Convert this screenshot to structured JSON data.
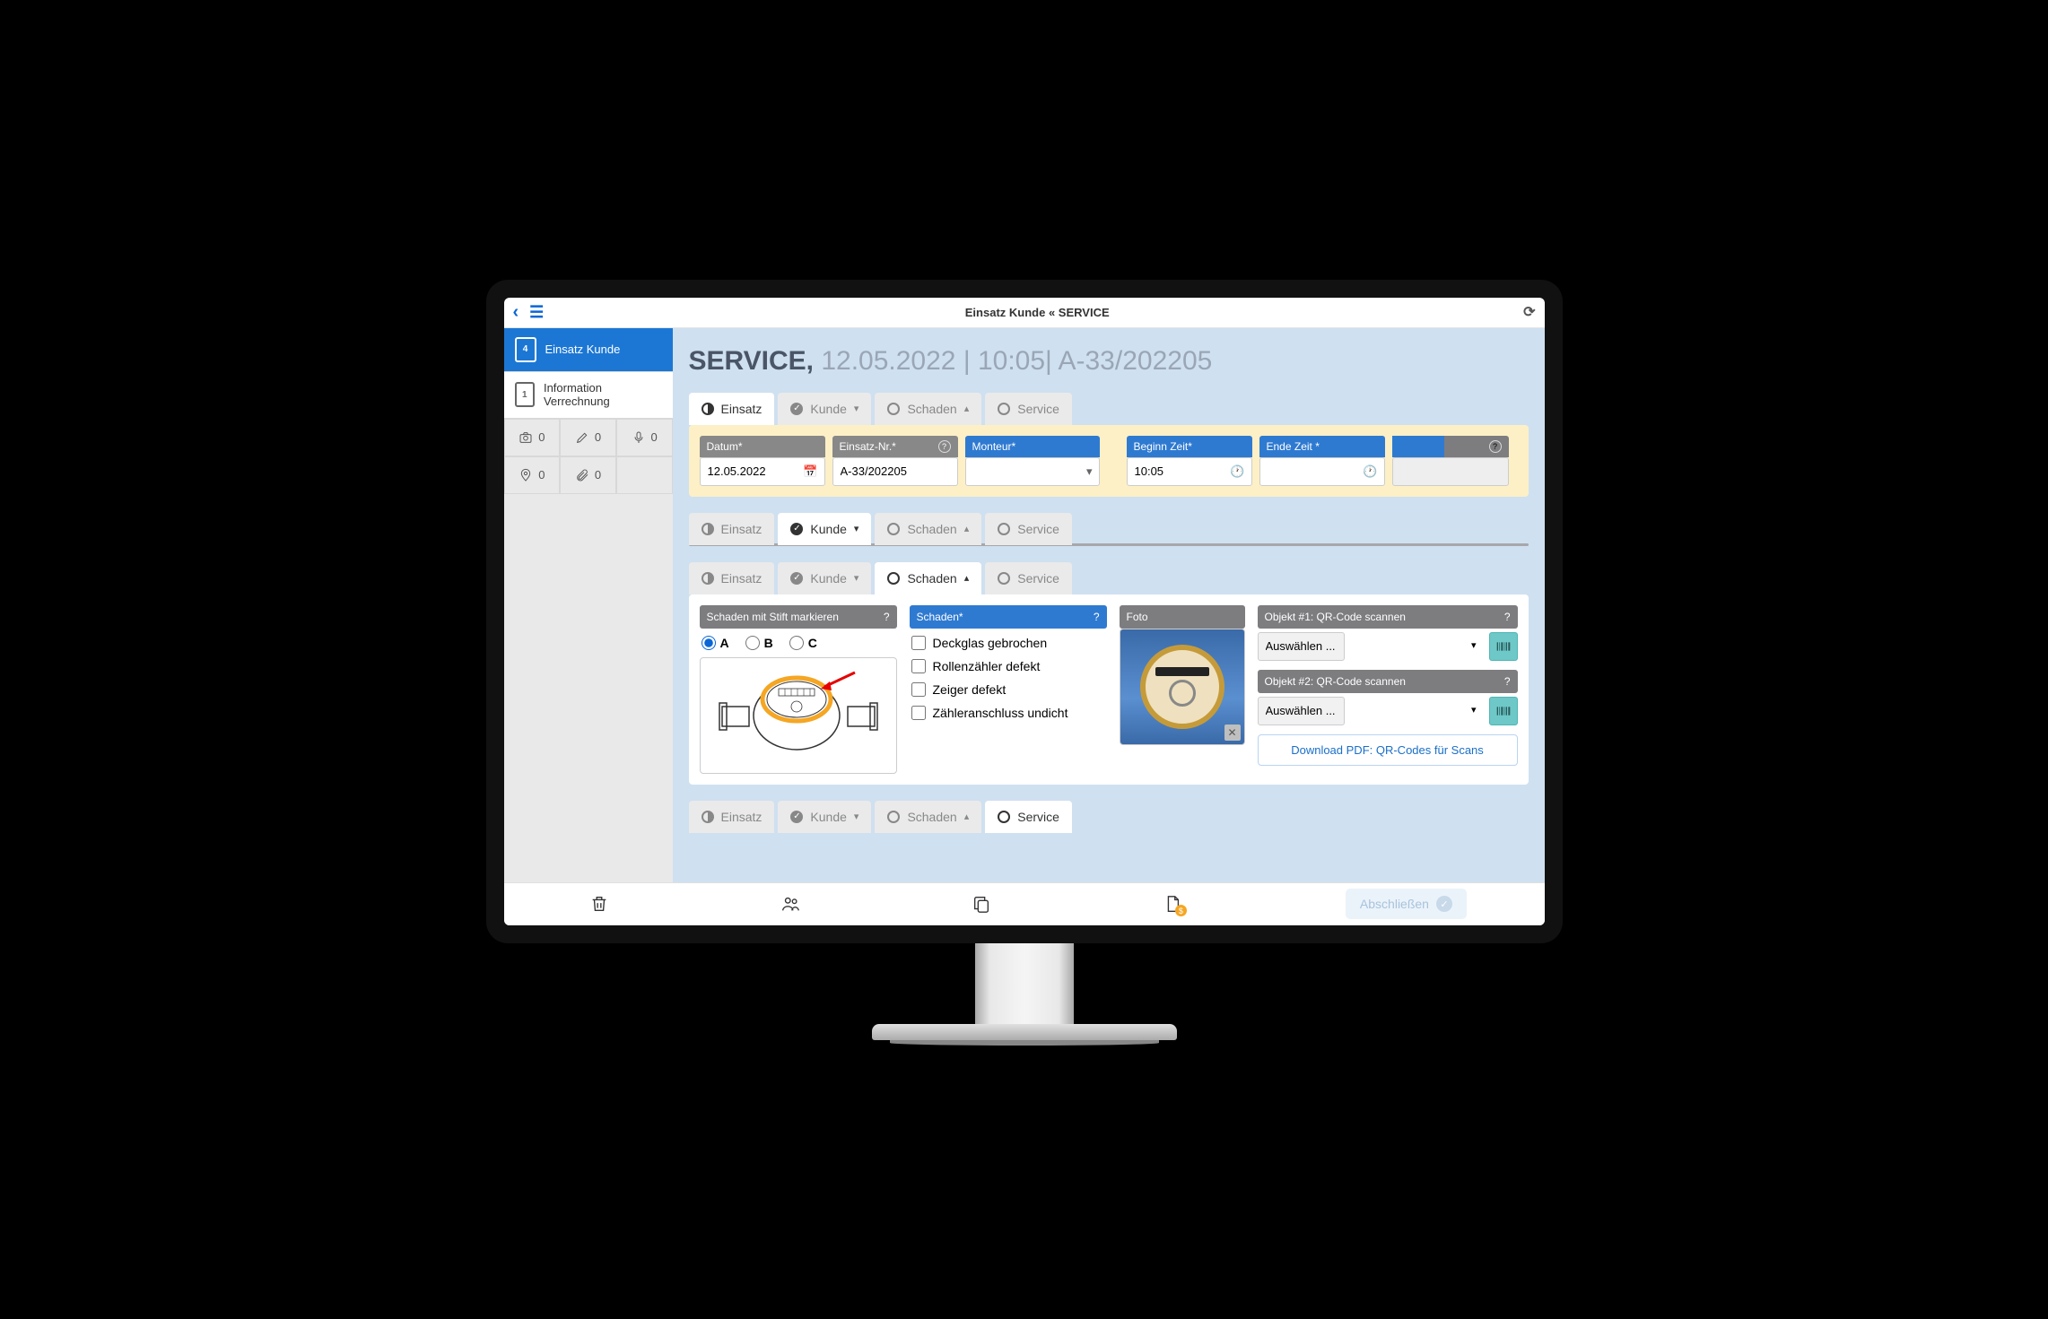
{
  "header": {
    "title": "Einsatz Kunde « SERVICE"
  },
  "sidebar": {
    "items": [
      {
        "badge": "4",
        "label": "Einsatz Kunde"
      },
      {
        "badge": "1",
        "label": "Information Verrechnung"
      }
    ],
    "counts": {
      "camera": "0",
      "pencil": "0",
      "mic": "0",
      "pin": "0",
      "attach": "0"
    }
  },
  "title": {
    "main": "SERVICE,",
    "sub": "12.05.2022 | 10:05| A-33/202205"
  },
  "tabs": {
    "einsatz": "Einsatz",
    "kunde": "Kunde",
    "schaden": "Schaden",
    "service": "Service"
  },
  "einsatz_fields": {
    "datum": {
      "label": "Datum*",
      "value": "12.05.2022"
    },
    "nr": {
      "label": "Einsatz-Nr.*",
      "value": "A-33/202205"
    },
    "monteur": {
      "label": "Monteur*",
      "value": ""
    },
    "beginn": {
      "label": "Beginn Zeit*",
      "value": "10:05"
    },
    "ende": {
      "label": "Ende Zeit *",
      "value": ""
    },
    "extra": {
      "label": "",
      "value": ""
    }
  },
  "schaden": {
    "mark_label": "Schaden mit Stift markieren",
    "options": [
      "A",
      "B",
      "C"
    ],
    "selected": "A",
    "list_label": "Schaden*",
    "items": [
      "Deckglas gebrochen",
      "Rollenzähler defekt",
      "Zeiger defekt",
      "Zähleranschluss undicht"
    ],
    "foto_label": "Foto",
    "qr1_label": "Objekt #1: QR-Code scannen",
    "qr2_label": "Objekt #2: QR-Code scannen",
    "select_placeholder": "Auswählen ...",
    "download_label": "Download PDF: QR-Codes für Scans"
  },
  "footer": {
    "complete": "Abschließen"
  }
}
